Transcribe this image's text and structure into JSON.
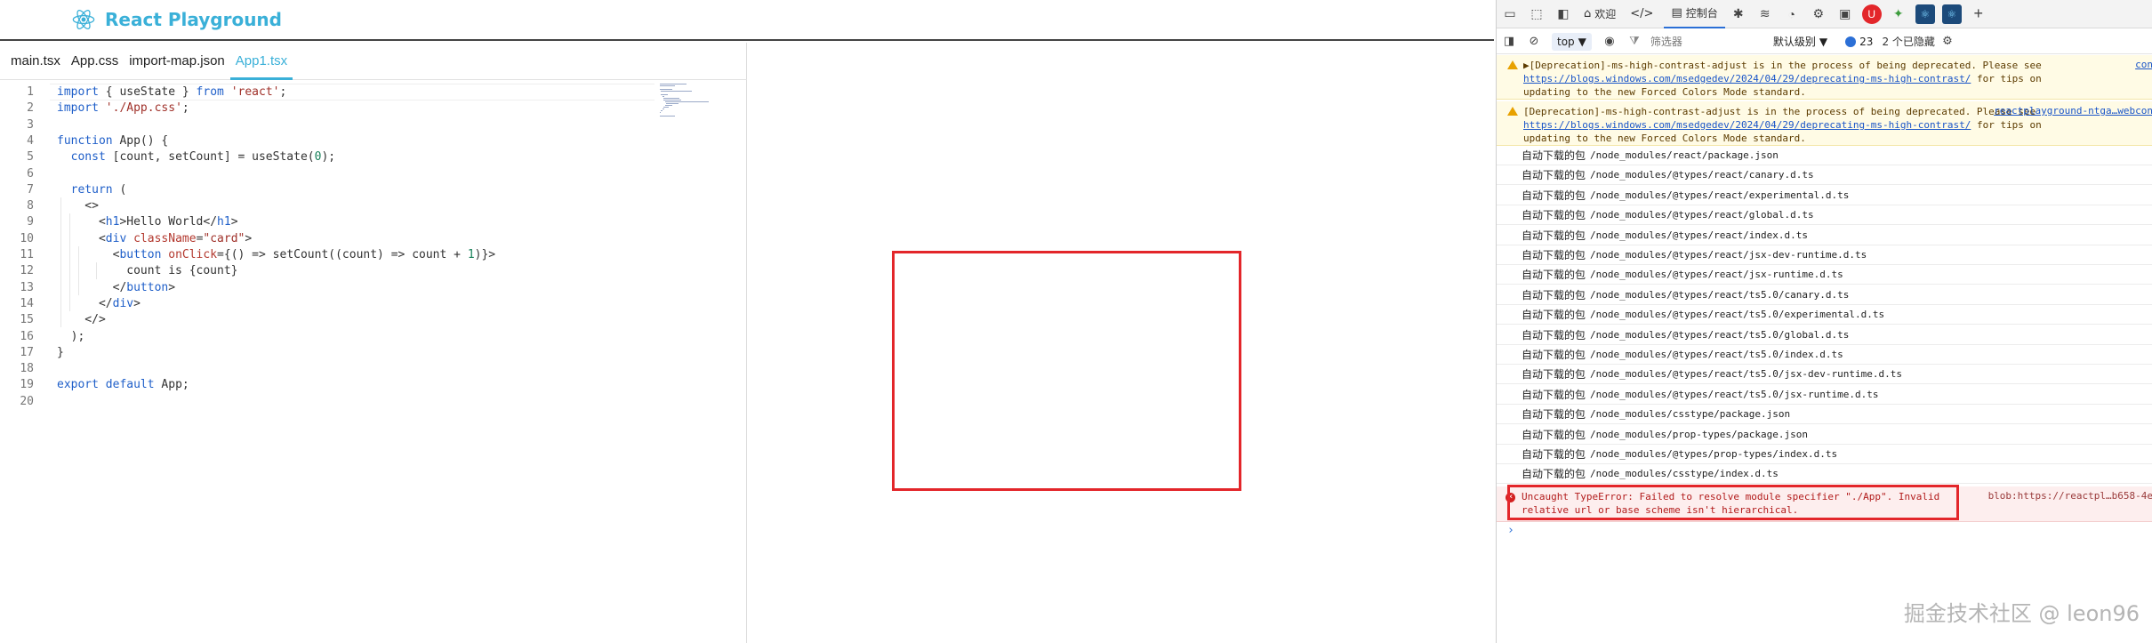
{
  "app": {
    "title": "React Playground",
    "brand_color": "#3ab0d8",
    "logo_icon": "react-atom-icon"
  },
  "editor": {
    "tabs": [
      {
        "label": "main.tsx",
        "active": false
      },
      {
        "label": "App.css",
        "active": false
      },
      {
        "label": "import-map.json",
        "active": false
      },
      {
        "label": "App1.tsx",
        "active": true
      }
    ],
    "code_lines": [
      {
        "n": "1",
        "text": "import { useState } from 'react';"
      },
      {
        "n": "2",
        "text": "import './App.css';"
      },
      {
        "n": "3",
        "text": ""
      },
      {
        "n": "4",
        "text": "function App() {"
      },
      {
        "n": "5",
        "text": "  const [count, setCount] = useState(0);"
      },
      {
        "n": "6",
        "text": ""
      },
      {
        "n": "7",
        "text": "  return ("
      },
      {
        "n": "8",
        "text": "    <>"
      },
      {
        "n": "9",
        "text": "      <h1>Hello World</h1>"
      },
      {
        "n": "10",
        "text": "      <div className=\"card\">"
      },
      {
        "n": "11",
        "text": "        <button onClick={() => setCount((count) => count + 1)}>"
      },
      {
        "n": "12",
        "text": "          count is {count}"
      },
      {
        "n": "13",
        "text": "        </button>"
      },
      {
        "n": "14",
        "text": "      </div>"
      },
      {
        "n": "15",
        "text": "    </>"
      },
      {
        "n": "16",
        "text": "  );"
      },
      {
        "n": "17",
        "text": "}"
      },
      {
        "n": "18",
        "text": ""
      },
      {
        "n": "19",
        "text": "export default App;"
      },
      {
        "n": "20",
        "text": ""
      }
    ]
  },
  "devtools": {
    "tabs": [
      {
        "label": "欢迎",
        "icon": "home-icon",
        "active": false
      },
      {
        "label": "",
        "icon": "code-icon",
        "active": false
      },
      {
        "label": "控制台",
        "icon": "console-icon",
        "active": true
      }
    ],
    "context": "top",
    "filter_placeholder": "筛选器",
    "level": "默认级别",
    "issues_count": "23",
    "hidden_label": "2 个已隐藏",
    "warnings": [
      {
        "pre": "▶[Deprecation]-ms-high-contrast-adjust is in the process of being deprecated. Please see ",
        "link": "https://blogs.windows.com/msedgedev/2024/04/29/deprecating-ms-high-contrast/",
        "post": " for tips on updating to the new Forced Colors Mode standard.",
        "source": "con"
      },
      {
        "pre": "[Deprecation]-ms-high-contrast-adjust is in the process of being deprecated. Please see ",
        "link": "https://blogs.windows.com/msedgedev/2024/04/29/deprecating-ms-high-contrast/",
        "post": " for tips on updating to the new Forced Colors Mode standard.",
        "source": "reactplayground-ntga…webcon"
      }
    ],
    "log_label": "自动下载的包",
    "logs": [
      "/node_modules/react/package.json",
      "/node_modules/@types/react/canary.d.ts",
      "/node_modules/@types/react/experimental.d.ts",
      "/node_modules/@types/react/global.d.ts",
      "/node_modules/@types/react/index.d.ts",
      "/node_modules/@types/react/jsx-dev-runtime.d.ts",
      "/node_modules/@types/react/jsx-runtime.d.ts",
      "/node_modules/@types/react/ts5.0/canary.d.ts",
      "/node_modules/@types/react/ts5.0/experimental.d.ts",
      "/node_modules/@types/react/ts5.0/global.d.ts",
      "/node_modules/@types/react/ts5.0/index.d.ts",
      "/node_modules/@types/react/ts5.0/jsx-dev-runtime.d.ts",
      "/node_modules/@types/react/ts5.0/jsx-runtime.d.ts",
      "/node_modules/csstype/package.json",
      "/node_modules/prop-types/package.json",
      "/node_modules/@types/prop-types/index.d.ts",
      "/node_modules/csstype/index.d.ts"
    ],
    "error": {
      "message": "Uncaught TypeError: Failed to resolve module specifier \"./App\". Invalid relative url or base scheme isn't hierarchical.",
      "source": "blob:https://reactpl…b658-4e"
    },
    "prompt": "›"
  },
  "watermark": "掘金技术社区 @ leon96"
}
